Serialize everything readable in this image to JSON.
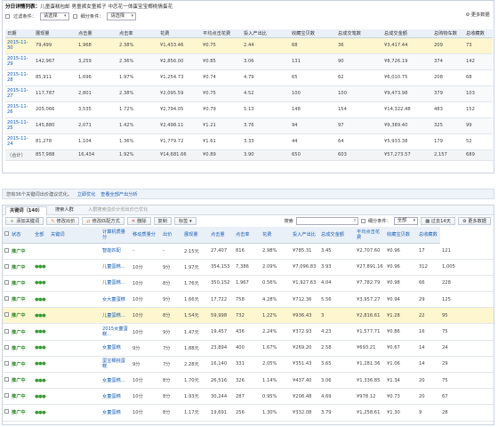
{
  "report": {
    "title_prefix": "分日详情列表：",
    "title_text": "儿童蛋糕包邮 男童裤女童裤子 中恋花一体蛋宝宝椰桃情蛋花",
    "filter1_label": "过滤条件：",
    "filter1_value": "请选择",
    "filter2_label": "细分条件：",
    "filter2_value": "请选择",
    "settings_label": "⚙ 更多数据"
  },
  "table1": {
    "headers": [
      "日期",
      "展现量",
      "点击量",
      "点击率",
      "花费",
      "平均点击花费",
      "投入产出比",
      "收藏宝贝数",
      "总成交笔数",
      "总成交金额",
      "总购物车数",
      "总收藏数"
    ],
    "rows": [
      [
        "2015-11-30",
        "79,499",
        "1,968",
        "2.38%",
        "¥1,433.46",
        "¥0.75",
        "2.44",
        "68",
        "36",
        "¥3,417.44",
        "209",
        "73"
      ],
      [
        "2015-11-29",
        "142,967",
        "3,259",
        "2.36%",
        "¥2,856.00",
        "¥0.85",
        "3.06",
        "131",
        "90",
        "¥8,726.19",
        "374",
        "142"
      ],
      [
        "2015-11-28",
        "85,911",
        "1,696",
        "1.97%",
        "¥1,254.73",
        "¥0.74",
        "4.79",
        "65",
        "62",
        "¥6,010.75",
        "208",
        "68"
      ],
      [
        "2015-11-27",
        "117,787",
        "2,801",
        "2.38%",
        "¥2,095.59",
        "¥0.75",
        "4.52",
        "100",
        "100",
        "¥9,473.98",
        "379",
        "103"
      ],
      [
        "2015-11-26",
        "205,066",
        "3,535",
        "1.72%",
        "¥2,794.05",
        "¥0.79",
        "5.13",
        "148",
        "154",
        "¥14,322.48",
        "483",
        "152"
      ],
      [
        "2015-11-25",
        "145,880",
        "2,071",
        "1.42%",
        "¥2,498.11",
        "¥1.21",
        "3.76",
        "94",
        "97",
        "¥9,389.40",
        "325",
        "99"
      ],
      [
        "2015-11-24",
        "81,278",
        "1,104",
        "1.36%",
        "¥1,779.72",
        "¥1.61",
        "3.33",
        "44",
        "64",
        "¥5,933.38",
        "179",
        "52"
      ]
    ],
    "total": [
      "（合计）",
      "857,988",
      "16,434",
      "1.92%",
      "¥14,681.66",
      "¥0.89",
      "3.90",
      "650",
      "603",
      "¥57,273.57",
      "2,157",
      "689"
    ]
  },
  "tip": {
    "text": "您有36个关键词出价建议优化。",
    "link1": "立即优化",
    "link2": "查看全部产出分析"
  },
  "tabs": {
    "keywords": "关键词（140）",
    "search_crowd": "搜索人群",
    "notice": "人群搜索溢价计划出价已优化"
  },
  "toolbar": {
    "add": "添加关键词",
    "modify_bid": "修改出价",
    "modify_match": "修改匹配方式",
    "delete": "删除",
    "copy": "复制",
    "tag": "标签",
    "search_label": "搜索",
    "subdivide": "细分条件：",
    "subdivide_value": "全部",
    "days": "过去14天",
    "more": "更多数据"
  },
  "table2": {
    "headers": [
      "",
      "状态",
      "全部",
      "关键词",
      "计算机质量分",
      "移动质量分",
      "出价",
      "展现量",
      "点击量",
      "点击率",
      "花费",
      "投入产出比",
      "总成交金额",
      "平均点击花费",
      "收藏宝贝数",
      "总收藏数"
    ],
    "rows": [
      [
        "推广中",
        "",
        "",
        "智能匹配",
        "-",
        "-",
        "2.15元",
        "27,407",
        "816",
        "2.98%",
        "¥785.31",
        "3.45",
        "¥2,707.60",
        "¥0.96",
        "17",
        "121"
      ],
      [
        "推广中",
        "●●●",
        "",
        "儿童蛋糕…",
        "10分",
        "9分",
        "1.97元",
        "354,153",
        "7,386",
        "2.09%",
        "¥7,096.83",
        "3.93",
        "¥27,891.16",
        "¥0.96",
        "312",
        "1,005"
      ],
      [
        "推广中",
        "●●●",
        "",
        "儿童蛋糕…",
        "10分",
        "8分",
        "1.76元",
        "350,152",
        "1,967",
        "0.56%",
        "¥1,927.63",
        "4.04",
        "¥7,782.79",
        "¥0.98",
        "66",
        "228"
      ],
      [
        "推广中",
        "●●●",
        "",
        "女大童蛋糕",
        "10分",
        "9分",
        "1.66元",
        "17,722",
        "758",
        "4.28%",
        "¥712.36",
        "5.56",
        "¥3,957.27",
        "¥0.94",
        "29",
        "125"
      ],
      [
        "推广中",
        "●●●",
        "",
        "儿童蛋糕…",
        "10分",
        "8分",
        "1.54元",
        "59,998",
        "732",
        "1.22%",
        "¥936.43",
        "3",
        "¥2,816.61",
        "¥1.28",
        "22",
        "95"
      ],
      [
        "推广中",
        "●●●",
        "",
        "2015女童蛋糕…",
        "10分",
        "9分",
        "1.47元",
        "19,457",
        "436",
        "2.24%",
        "¥372.93",
        "4.23",
        "¥1,577.71",
        "¥0.86",
        "16",
        "75"
      ],
      [
        "推广中",
        "●●●",
        "",
        "女童蛋糕",
        "9分",
        "7分",
        "1.88元",
        "23,894",
        "400",
        "1.67%",
        "¥269.20",
        "2.58",
        "¥693.21",
        "¥0.67",
        "14",
        "24"
      ],
      [
        "推广中",
        "●●●",
        "",
        "蛋宝椰桃蛋糕",
        "9分",
        "7分",
        "2.28元",
        "16,140",
        "331",
        "2.05%",
        "¥351.43",
        "3.65",
        "¥1,281.36",
        "¥1.06",
        "14",
        "29"
      ],
      [
        "推广中",
        "●●●",
        "",
        "女童蛋糕…",
        "10分",
        "8分",
        "1.70元",
        "26,516",
        "326",
        "1.14%",
        "¥437.40",
        "3.06",
        "¥1,336.85",
        "¥1.34",
        "20",
        "75"
      ],
      [
        "推广中",
        "●●●",
        "",
        "女童蛋糕",
        "10分",
        "8分",
        "1.93元",
        "30,244",
        "287",
        "0.95%",
        "¥208.48",
        "4.69",
        "¥978.12",
        "¥0.73",
        "20",
        "67"
      ],
      [
        "推广中",
        "●●●",
        "",
        "女童蛋糕",
        "10分",
        "8分",
        "1.17元",
        "19,691",
        "256",
        "1.30%",
        "¥332.08",
        "3.79",
        "¥1,258.61",
        "¥1.30",
        "9",
        "28"
      ]
    ]
  }
}
